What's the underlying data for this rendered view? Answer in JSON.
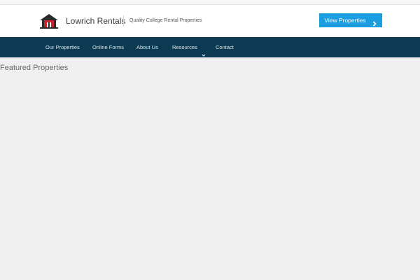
{
  "header": {
    "site_title": "Lowrich Rentals",
    "tagline": "Quality College Rental Properties",
    "cta_label": "View Properties"
  },
  "nav": {
    "items": [
      {
        "label": "Our Properties"
      },
      {
        "label": "Online Forms"
      },
      {
        "label": "About Us"
      },
      {
        "label": "Resources"
      },
      {
        "label": "Contact"
      }
    ]
  },
  "main": {
    "section_title": "Featured Properties"
  },
  "colors": {
    "nav_bg": "#0b3a52",
    "cta_bg": "#1a9ee0",
    "page_bg": "#efefef",
    "logo_red": "#c8242b"
  },
  "icons": {
    "logo": "house-logo-icon",
    "cta_arrow": "chevron-right-icon",
    "dropdown": "chevron-down-icon"
  }
}
